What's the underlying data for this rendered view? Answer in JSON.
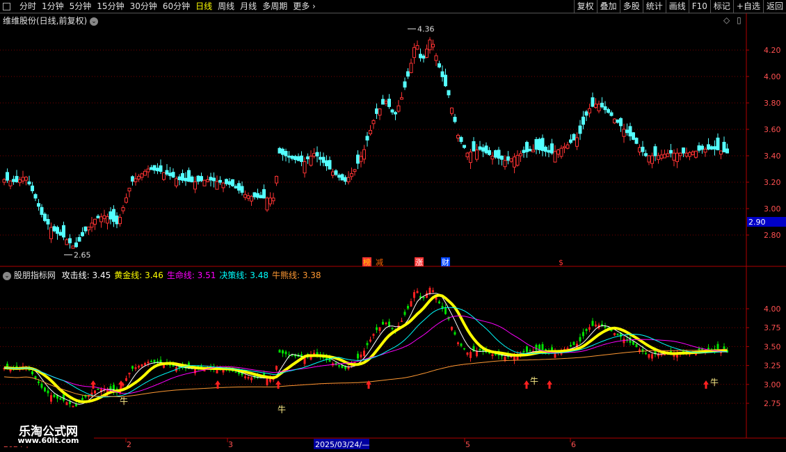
{
  "toolbar": {
    "periods": [
      "分时",
      "1分钟",
      "5分钟",
      "15分钟",
      "30分钟",
      "60分钟",
      "日线",
      "周线",
      "月线",
      "多周期",
      "更多"
    ],
    "active_period": "日线",
    "functions": [
      "复权",
      "叠加",
      "多股",
      "统计",
      "画线",
      "F10",
      "标记",
      "+自选",
      "返回"
    ]
  },
  "main": {
    "title": "维维股份(日线,前复权)",
    "high_label": "4.36",
    "low_label": "2.65",
    "current_price": "2.90",
    "event_markers": [
      "榜",
      "减",
      "涨",
      "财",
      "$"
    ],
    "price_ticks": [
      "4.20",
      "4.00",
      "3.80",
      "3.60",
      "3.40",
      "3.20",
      "3.00",
      "2.80"
    ]
  },
  "indicator": {
    "name": "股朋指标网",
    "lines": [
      {
        "label": "攻击线:",
        "value": "3.45",
        "color": "#ffffff"
      },
      {
        "label": "黄金线:",
        "value": "3.46",
        "color": "#ffff00"
      },
      {
        "label": "生命线:",
        "value": "3.51",
        "color": "#ff00ff"
      },
      {
        "label": "决策线:",
        "value": "3.48",
        "color": "#00ffff"
      },
      {
        "label": "牛熊线:",
        "value": "3.38",
        "color": "#ff9933"
      }
    ],
    "ticks": [
      "4.00",
      "3.75",
      "3.50",
      "3.25",
      "3.00",
      "2.75"
    ],
    "bull_label": "牛"
  },
  "date_axis": {
    "labels": [
      "2024年",
      "2",
      "3",
      "5",
      "6"
    ],
    "highlight": "2025/03/24/—"
  },
  "watermark": {
    "line1": "乐淘公式网",
    "line2": "www.60lt.com"
  },
  "colors": {
    "up": "#ff3333",
    "down": "#54ffff",
    "grid": "#7a0000",
    "axis": "#b00000"
  }
}
